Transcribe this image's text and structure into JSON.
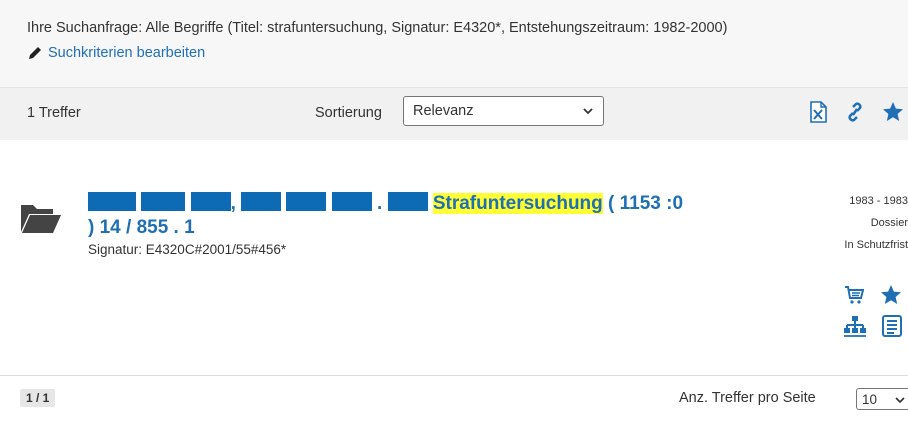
{
  "query": {
    "text": "Ihre Suchanfrage: Alle Begriffe (Titel: strafuntersuchung, Signatur: E4320*, Entstehungszeitraum: 1982-2000)",
    "edit_label": "Suchkriterien bearbeiten"
  },
  "toolbar": {
    "hits": "1 Treffer",
    "sort_label": "Sortierung",
    "sort_value": "Relevanz",
    "icons": [
      "excel-export-icon",
      "link-icon",
      "star-icon"
    ]
  },
  "result": {
    "sep1": ",",
    "sep2": ".",
    "highlight": "Strafuntersuchung",
    "title_rest": "( 1153 :0",
    "title_line2": ") 14 / 855 . 1",
    "signatur": "Signatur: E4320C#2001/55#456*",
    "date_range": "1983 - 1983",
    "level": "Dossier",
    "status": "In Schutzfrist",
    "icons": [
      "cart-icon",
      "star-icon",
      "hierarchy-icon",
      "details-icon"
    ]
  },
  "footer": {
    "page": "1 / 1",
    "per_page_label": "Anz. Treffer pro Seite",
    "per_page_value": "10"
  },
  "colors": {
    "link": "#1f6fb5",
    "highlight": "#ffff33",
    "redaction": "#0d6bb5"
  }
}
